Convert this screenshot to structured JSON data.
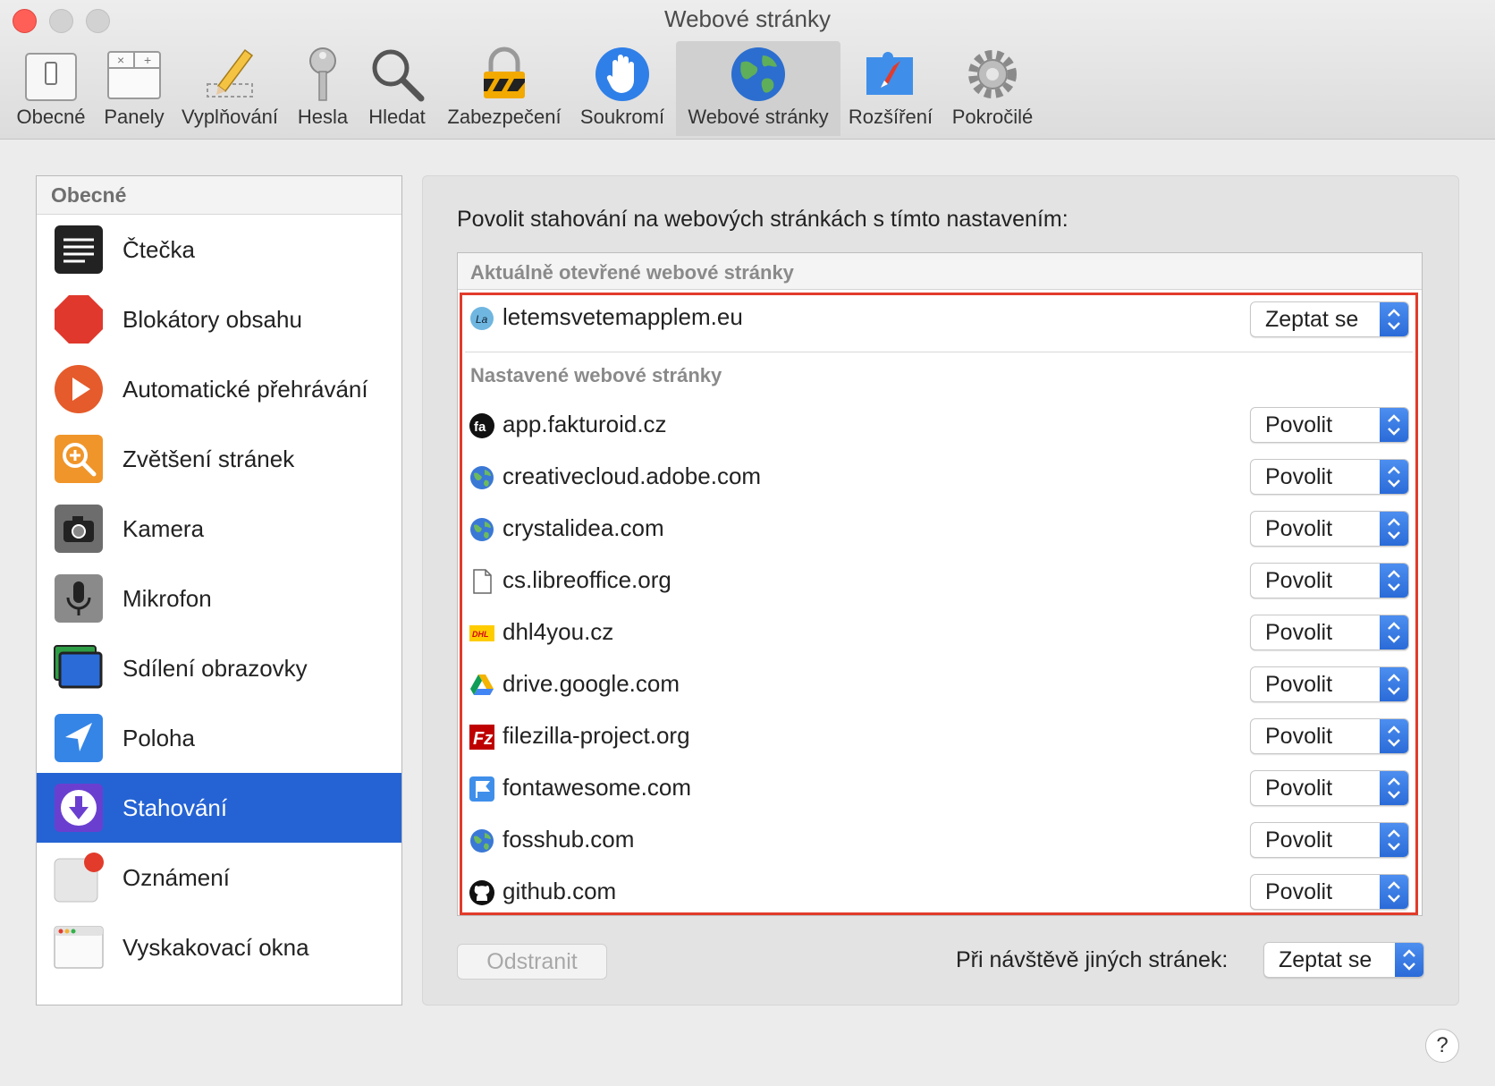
{
  "window": {
    "title": "Webové stránky"
  },
  "toolbar": {
    "items": [
      {
        "label": "Obecné",
        "icon": "switch-icon"
      },
      {
        "label": "Panely",
        "icon": "tabs-icon"
      },
      {
        "label": "Vyplňování",
        "icon": "pencil-icon"
      },
      {
        "label": "Hesla",
        "icon": "key-icon"
      },
      {
        "label": "Hledat",
        "icon": "magnifier-icon"
      },
      {
        "label": "Zabezpečení",
        "icon": "lock-icon"
      },
      {
        "label": "Soukromí",
        "icon": "hand-icon"
      },
      {
        "label": "Webové stránky",
        "icon": "globe-icon",
        "active": true
      },
      {
        "label": "Rozšíření",
        "icon": "puzzle-compass-icon"
      },
      {
        "label": "Pokročilé",
        "icon": "gear-icon"
      }
    ]
  },
  "sidebar": {
    "header": "Obecné",
    "items": [
      {
        "label": "Čtečka",
        "icon": "reader-icon"
      },
      {
        "label": "Blokátory obsahu",
        "icon": "stop-icon"
      },
      {
        "label": "Automatické přehrávání",
        "icon": "play-icon"
      },
      {
        "label": "Zvětšení stránek",
        "icon": "zoom-icon"
      },
      {
        "label": "Kamera",
        "icon": "camera-icon"
      },
      {
        "label": "Mikrofon",
        "icon": "microphone-icon"
      },
      {
        "label": "Sdílení obrazovky",
        "icon": "screen-share-icon"
      },
      {
        "label": "Poloha",
        "icon": "location-icon"
      },
      {
        "label": "Stahování",
        "icon": "download-icon",
        "selected": true
      },
      {
        "label": "Oznámení",
        "icon": "notification-icon"
      },
      {
        "label": "Vyskakovací okna",
        "icon": "popup-window-icon"
      }
    ]
  },
  "panel": {
    "heading": "Povolit stahování na webových stránkách s tímto nastavením:",
    "list_header": "Aktuálně otevřené webové stránky",
    "current_site": {
      "domain": "letemsvetemapplem.eu",
      "setting": "Zeptat se"
    },
    "configured_label": "Nastavené webové stránky",
    "configured_sites": [
      {
        "domain": "app.fakturoid.cz",
        "setting": "Povolit",
        "icon": "fakturoid-icon"
      },
      {
        "domain": "creativecloud.adobe.com",
        "setting": "Povolit",
        "icon": "globe-icon"
      },
      {
        "domain": "crystalidea.com",
        "setting": "Povolit",
        "icon": "globe-icon"
      },
      {
        "domain": "cs.libreoffice.org",
        "setting": "Povolit",
        "icon": "document-icon"
      },
      {
        "domain": "dhl4you.cz",
        "setting": "Povolit",
        "icon": "dhl-icon"
      },
      {
        "domain": "drive.google.com",
        "setting": "Povolit",
        "icon": "google-drive-icon"
      },
      {
        "domain": "filezilla-project.org",
        "setting": "Povolit",
        "icon": "filezilla-icon"
      },
      {
        "domain": "fontawesome.com",
        "setting": "Povolit",
        "icon": "flag-icon"
      },
      {
        "domain": "fosshub.com",
        "setting": "Povolit",
        "icon": "globe-icon"
      },
      {
        "domain": "github.com",
        "setting": "Povolit",
        "icon": "github-icon"
      }
    ],
    "remove_button": "Odstranit",
    "other_sites_label": "Při návštěvě jiných stránek:",
    "other_sites_setting": "Zeptat se"
  },
  "help_label": "?",
  "colors": {
    "selection": "#2563d4",
    "highlight_border": "#e23b2b",
    "select_accent": "#2a6bd8"
  }
}
